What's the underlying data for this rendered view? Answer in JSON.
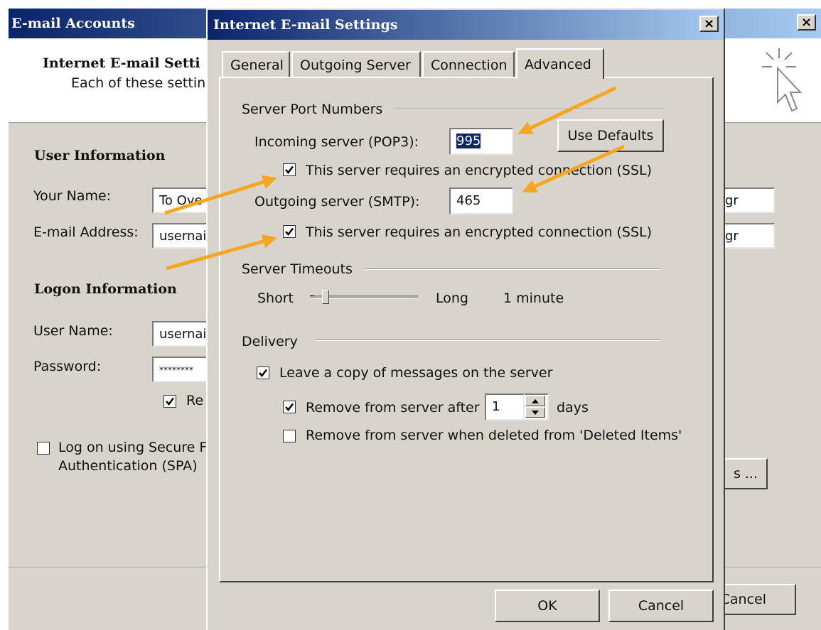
{
  "colors": {
    "titlebar_start": "#0a246a",
    "titlebar_end": "#a6caf0",
    "dialog_bg": "#d8d4cc",
    "arrow": "#f5a623"
  },
  "back_window": {
    "title": "E-mail Accounts",
    "header_title": "Internet E-mail Setti",
    "header_sub": "Each of these settin",
    "user_info_heading": "User Information",
    "your_name_label": "Your Name:",
    "your_name_value": "To Ove",
    "your_name_right": "gr",
    "email_label": "E-mail Address:",
    "email_value": "usernai",
    "email_right": "gr",
    "logon_heading": "Logon Information",
    "username_label": "User Name:",
    "username_value": "usernai",
    "password_label": "Password:",
    "password_value": "********",
    "remember_label": "Re",
    "spa_label_line1": "Log on using Secure F",
    "spa_label_line2": "Authentication (SPA)",
    "more_settings_label": "s ...",
    "cancel_label": "Cancel"
  },
  "dialog": {
    "title": "Internet E-mail Settings",
    "tabs": [
      "General",
      "Outgoing Server",
      "Connection",
      "Advanced"
    ],
    "active_tab": "Advanced",
    "ports_group": "Server Port Numbers",
    "incoming_label": "Incoming server (POP3):",
    "incoming_value": "995",
    "use_defaults": "Use Defaults",
    "ssl_label": "This server requires an encrypted connection (SSL)",
    "outgoing_label": "Outgoing server (SMTP):",
    "outgoing_value": "465",
    "ssl_label_2": "This server requires an encrypted connection (SSL)",
    "timeouts_group": "Server Timeouts",
    "short_label": "Short",
    "long_label": "Long",
    "timeout_value": "1 minute",
    "timeout_level": 0.12,
    "delivery_group": "Delivery",
    "leave_copy_label": "Leave a copy of messages on the server",
    "remove_after_label": "Remove from server after",
    "remove_after_value": "1",
    "days_label": "days",
    "remove_deleted_label": "Remove from server when deleted from 'Deleted Items'",
    "ok_label": "OK",
    "cancel_label": "Cancel",
    "close_glyph": "×"
  }
}
